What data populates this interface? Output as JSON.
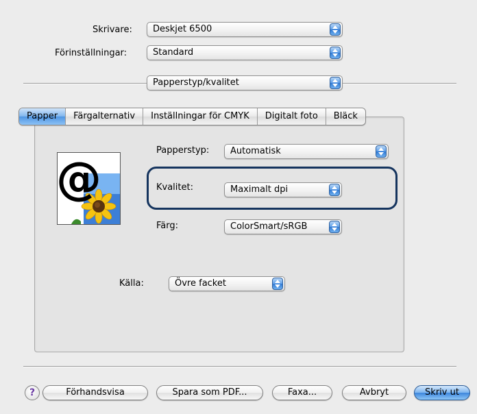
{
  "printer": {
    "label": "Skrivare:",
    "value": "Deskjet 6500"
  },
  "presets": {
    "label": "Förinställningar:",
    "value": "Standard"
  },
  "pane_select": {
    "value": "Papperstyp/kvalitet"
  },
  "tabs": [
    {
      "label": "Papper"
    },
    {
      "label": "Färgalternativ"
    },
    {
      "label": "Inställningar för CMYK"
    },
    {
      "label": "Digitalt foto"
    },
    {
      "label": "Bläck"
    }
  ],
  "paper": {
    "paper_type": {
      "label": "Papperstyp:",
      "value": "Automatisk"
    },
    "quality": {
      "label": "Kvalitet:",
      "value": "Maximalt dpi"
    },
    "color": {
      "label": "Färg:",
      "value": "ColorSmart/sRGB"
    },
    "source": {
      "label": "Källa:",
      "value": "Övre facket"
    }
  },
  "buttons": {
    "help": "?",
    "preview": "Förhandsvisa",
    "save_pdf": "Spara som PDF...",
    "fax": "Faxa...",
    "cancel": "Avbryt",
    "print": "Skriv ut"
  },
  "colors": {
    "accent": "#4f95e2",
    "highlight_border": "#15345e"
  },
  "icons": {
    "preview_image": "at-sign-sunflower-icon",
    "popup_arrows": "updown-arrows-icon"
  }
}
